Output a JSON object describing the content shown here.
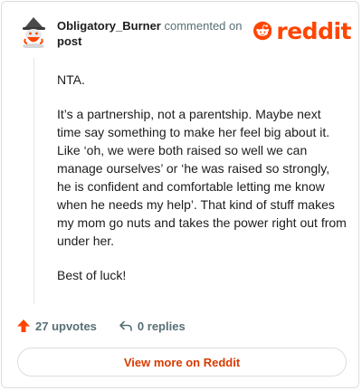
{
  "header": {
    "username": "Obligatory_Burner",
    "action": "commented on",
    "target": "post",
    "brand": "reddit",
    "brand_color": "#ff4500",
    "avatar_icon": "snoo-wizard-avatar-icon"
  },
  "comment": {
    "paragraphs": [
      "NTA.",
      "It’s a partnership, not a parentship. Maybe next time say something to make her feel big about it. Like ‘oh, we were both raised so well we can manage ourselves’ or ‘he was raised so strongly, he is confident and comfortable letting me know when he needs my help’. That kind of stuff makes my mom go nuts and takes the power right out from under her.",
      "Best of luck!"
    ]
  },
  "actions": {
    "upvotes": "27 upvotes",
    "replies": "0 replies",
    "upvote_icon": "upvote-arrow-icon",
    "reply_icon": "reply-arrow-icon"
  },
  "footer": {
    "view_more": "View more on Reddit",
    "link_color": "#d93a00"
  }
}
